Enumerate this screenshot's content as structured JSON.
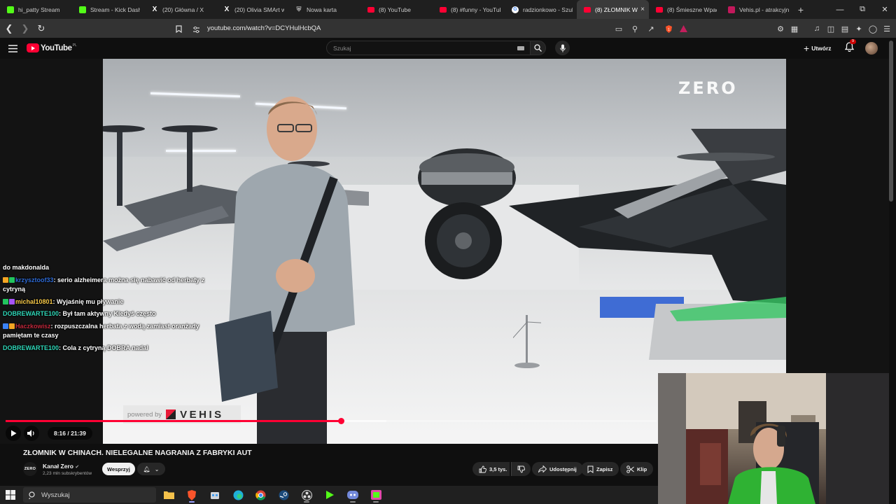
{
  "browser": {
    "tabs": [
      {
        "label": "hi_patty Stream",
        "icon": "kick-icon",
        "active": false
      },
      {
        "label": "Stream - Kick Dashb",
        "icon": "kick-icon",
        "active": false
      },
      {
        "label": "(20) Główna / X",
        "icon": "x-icon",
        "active": false
      },
      {
        "label": "(20) Olivia SMArt w",
        "icon": "x-icon",
        "active": false
      },
      {
        "label": "Nowa karta",
        "icon": "shield-icon",
        "active": false
      },
      {
        "label": "(8) YouTube",
        "icon": "youtube-icon",
        "active": false
      },
      {
        "label": "(8) #funny - YouTub",
        "icon": "youtube-icon",
        "active": false
      },
      {
        "label": "radzionkowo - Szuk",
        "icon": "google-icon",
        "active": false
      },
      {
        "label": "(8) ZŁOMNIK W",
        "icon": "youtube-icon",
        "active": true
      },
      {
        "label": "(8) Śmieszne Wpadk",
        "icon": "youtube-icon",
        "active": false
      },
      {
        "label": "Vehis.pl - atrakcyjn",
        "icon": "vehis-icon",
        "active": false
      }
    ],
    "url": "youtube.com/watch?v=DCYHulHcbQA"
  },
  "youtube": {
    "logo_text": "YouTube",
    "logo_country": "PL",
    "search_placeholder": "Szukaj",
    "create_label": "Utwórz",
    "notification_count": "9"
  },
  "player": {
    "time": "8:16 / 21:39",
    "progress": 0.515,
    "buffer_end": 0.585,
    "overlay_brand": "ZERO",
    "powered_by": "powered by",
    "sponsor": "VEHIS"
  },
  "chat": {
    "messages": [
      {
        "user": "",
        "user_color": "gold",
        "text": "do makdonalda"
      },
      {
        "user": "krzysztoof33",
        "user_color": "blue",
        "text": "serio alzheimera można się nabawić od herbaty z cytryną"
      },
      {
        "user": "michal10801",
        "user_color": "gold",
        "text": "Wyjaśnię mu pływanie"
      },
      {
        "user": "DOBREWARTE100",
        "user_color": "green",
        "text": "Był tam aktywny Kiedyś często"
      },
      {
        "user": "Haczkowisz",
        "user_color": "red",
        "text": "rozpuszczalna herbata z wodą zamiast oranżady pamiętam te czasy"
      },
      {
        "user": "DOBREWARTE100",
        "user_color": "green",
        "text": "Cola z cytryną DOBRA nadal"
      }
    ]
  },
  "video": {
    "title": "ZŁOMNIK W CHINACH. NIELEGALNE NAGRANIA Z FABRYKI AUT",
    "channel_logo": "ZERO",
    "channel_name": "Kanał Zero",
    "subscribers": "2,23 mln subskrybentów",
    "support_label": "Wesprzyj",
    "likes": "3,5 tys.",
    "share_label": "Udostępnij",
    "save_label": "Zapisz",
    "clip_label": "Klip"
  },
  "taskbar": {
    "search_placeholder": "Wyszukaj"
  }
}
